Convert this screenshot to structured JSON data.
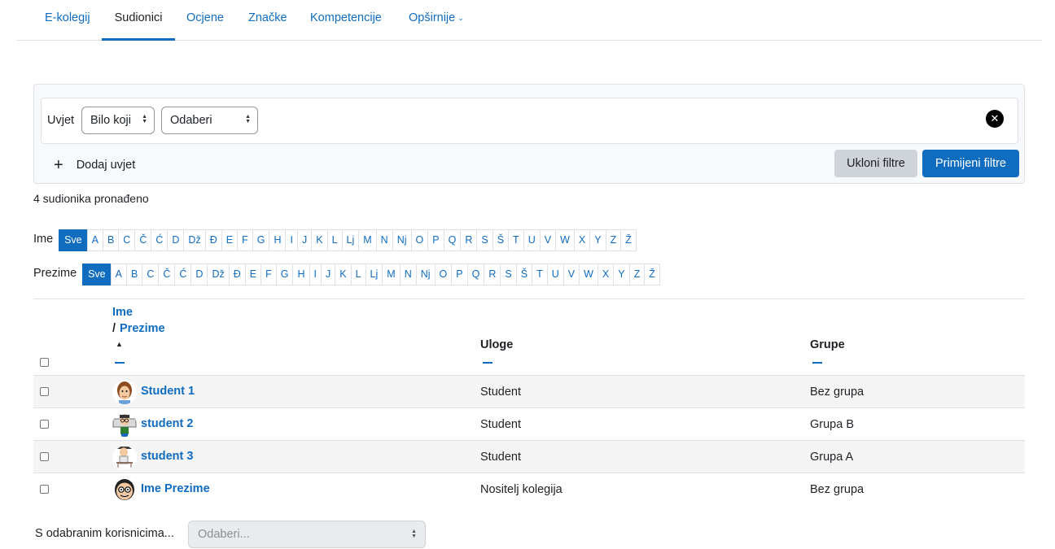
{
  "nav": {
    "tabs": [
      {
        "label": "E-kolegij"
      },
      {
        "label": "Sudionici"
      },
      {
        "label": "Ocjene"
      },
      {
        "label": "Značke"
      },
      {
        "label": "Kompetencije"
      },
      {
        "label": "Opširnije"
      }
    ]
  },
  "filters": {
    "condition_label": "Uvjet",
    "match_select": "Bilo koji",
    "type_select": "Odaberi",
    "add_condition": "Dodaj uvjet",
    "clear_button": "Ukloni filtre",
    "apply_button": "Primijeni filtre"
  },
  "result_count": "4 sudionika pronađeno",
  "initials": {
    "first_label": "Ime",
    "last_label": "Prezime",
    "all_label": "Sve",
    "letters": [
      "A",
      "B",
      "C",
      "Č",
      "Ć",
      "D",
      "Dž",
      "Đ",
      "E",
      "F",
      "G",
      "H",
      "I",
      "J",
      "K",
      "L",
      "Lj",
      "M",
      "N",
      "Nj",
      "O",
      "P",
      "Q",
      "R",
      "S",
      "Š",
      "T",
      "U",
      "V",
      "W",
      "X",
      "Y",
      "Z",
      "Ž"
    ]
  },
  "table": {
    "headers": {
      "firstname": "Ime",
      "separator": "/",
      "lastname": "Prezime",
      "roles": "Uloge",
      "groups": "Grupe"
    },
    "rows": [
      {
        "name": "Student 1",
        "role": "Student",
        "group": "Bez grupa",
        "avatar": "avatar-1"
      },
      {
        "name": "student 2",
        "role": "Student",
        "group": "Grupa B",
        "avatar": "avatar-2"
      },
      {
        "name": "student 3",
        "role": "Student",
        "group": "Grupa A",
        "avatar": "avatar-3"
      },
      {
        "name": "Ime Prezime",
        "role": "Nositelj kolegija",
        "group": "Bez grupa",
        "avatar": "avatar-4"
      }
    ]
  },
  "bulk": {
    "label": "S odabranim korisnicima...",
    "placeholder": "Odaberi..."
  },
  "colors": {
    "primary": "#0f6cbf",
    "text": "#1d2125",
    "border": "#dee2e6"
  }
}
